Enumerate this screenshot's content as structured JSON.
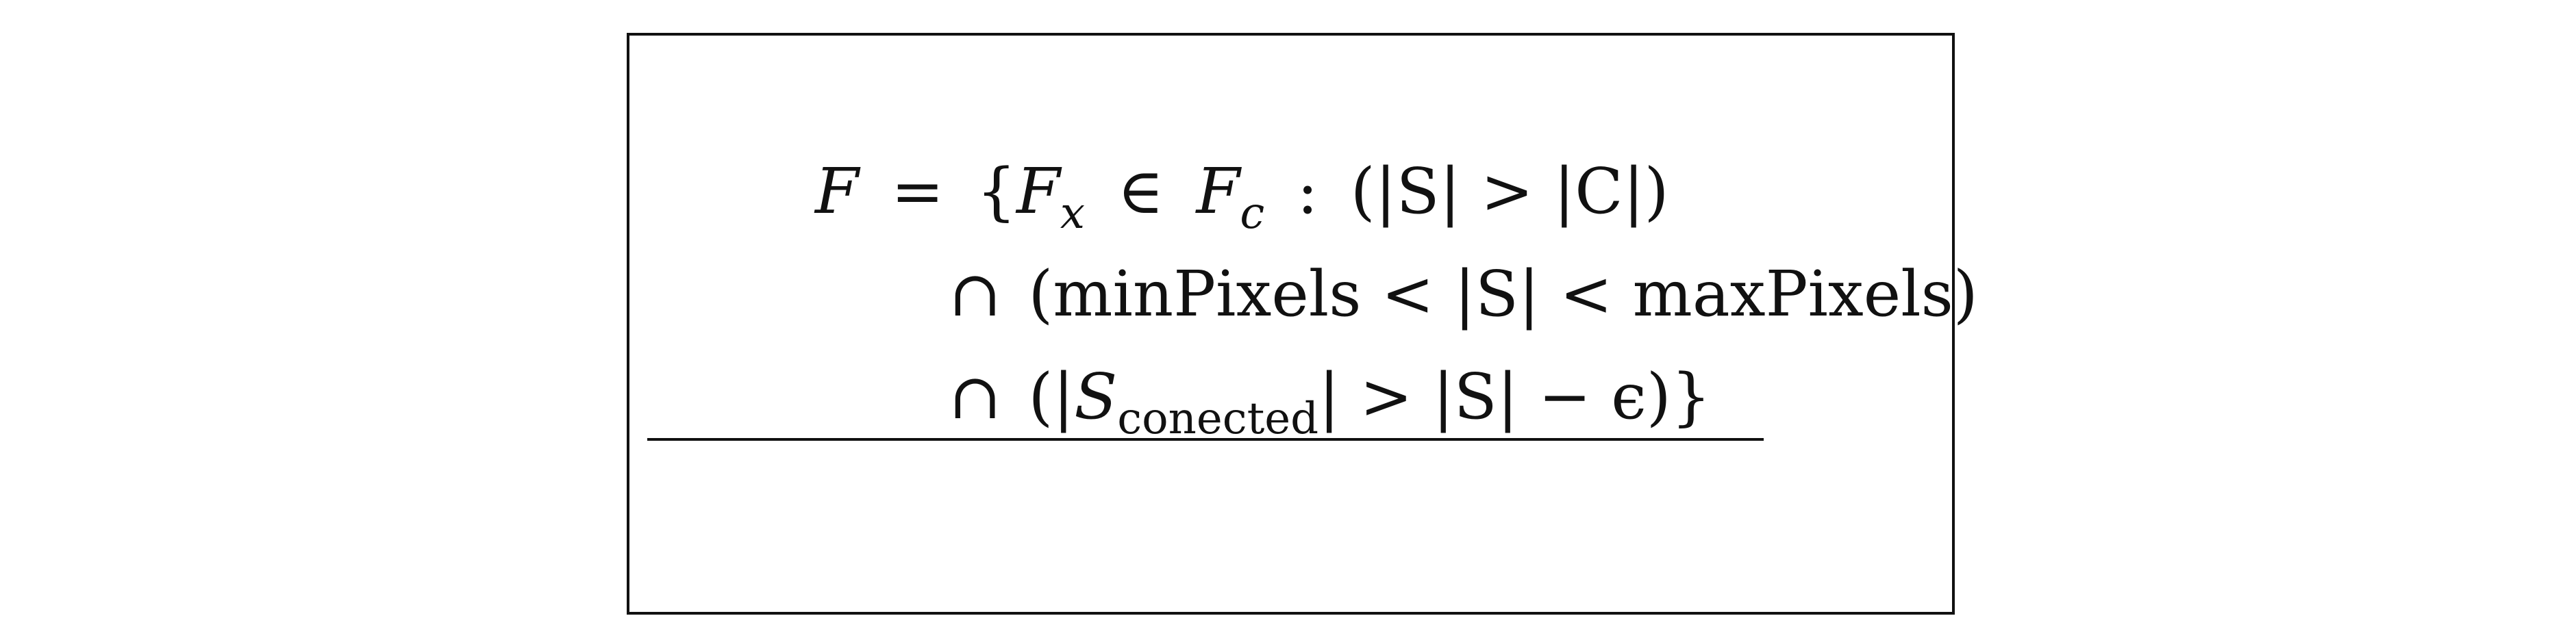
{
  "equation": {
    "line1": {
      "F": "F",
      "eq": "=",
      "lbrace": "{",
      "Fx_base": "F",
      "Fx_sub": "x",
      "in": "∈",
      "Fc_base": "F",
      "Fc_sub": "c",
      "colon": ":",
      "expr": "(|S| > |C|)"
    },
    "line2": {
      "cap": "∩",
      "expr": "(minPixels < |S| < maxPixels)"
    },
    "line3": {
      "cap": "∩",
      "open": "(|",
      "S": "S",
      "sub": "conected",
      "rest": "| > |S| − ϵ)}"
    }
  }
}
